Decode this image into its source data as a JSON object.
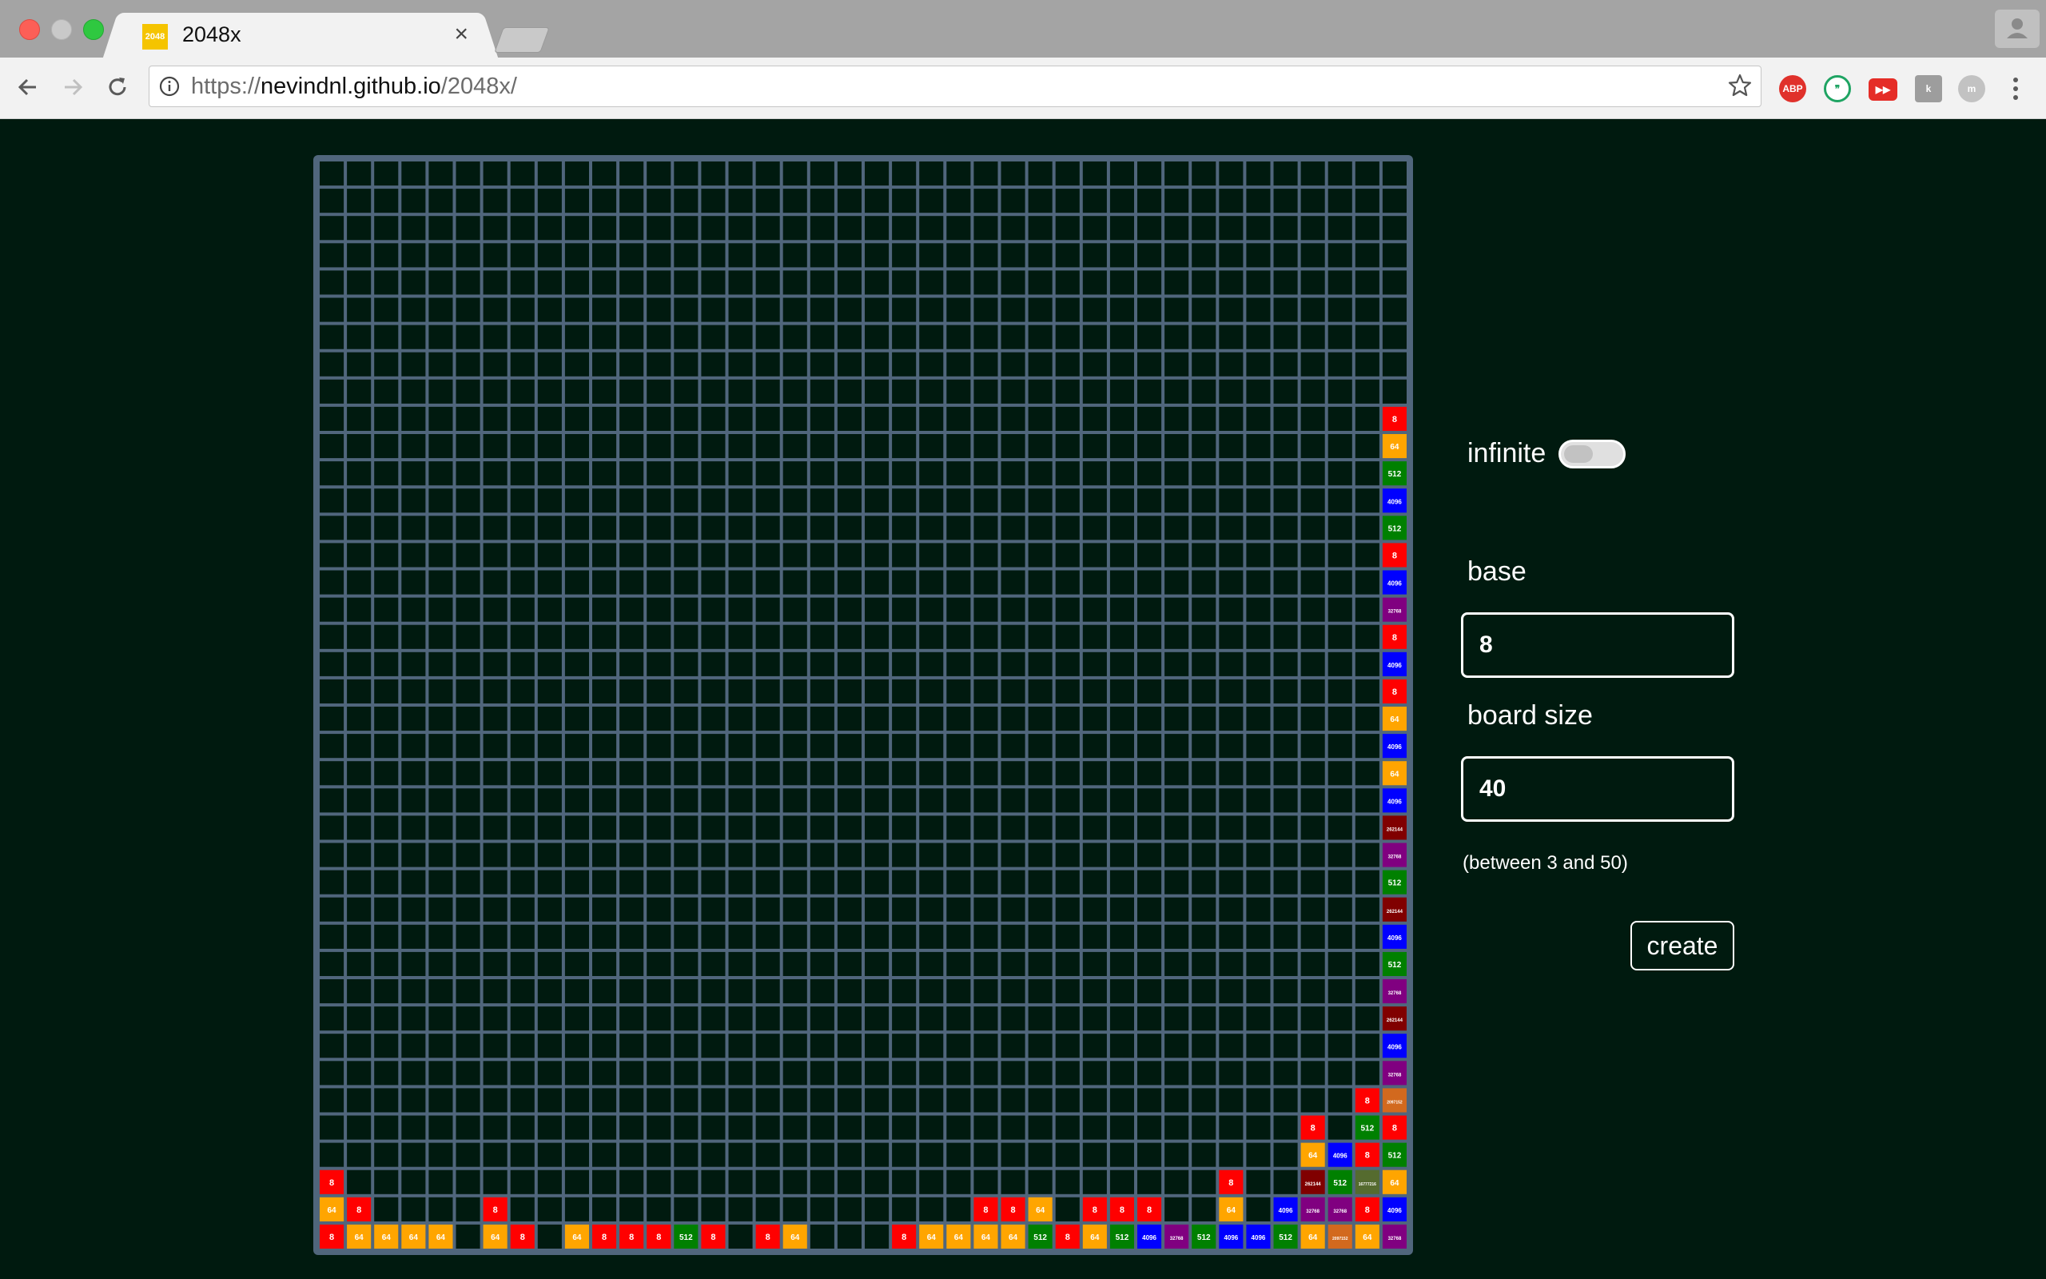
{
  "browser": {
    "tab_title": "2048x",
    "tab_favicon_text": "2048",
    "url_scheme": "https://",
    "url_host": "nevindnl.github.io",
    "url_path": "/2048x/",
    "extensions": [
      "adblock-plus-icon",
      "hangouts-icon",
      "youtube-icon",
      "k-extension-icon",
      "m-extension-icon"
    ],
    "ext_abp_label": "ABP"
  },
  "controls": {
    "infinite_label": "infinite",
    "infinite_on": false,
    "base_label": "base",
    "base_value": "8",
    "size_label": "board size",
    "size_value": "40",
    "size_note": "(between 3 and 50)",
    "create_label": "create"
  },
  "board": {
    "size": 40,
    "colors": {
      "8": "#ff0000",
      "64": "#ffa500",
      "512": "#008000",
      "4096": "#0000ff",
      "32768": "#800080",
      "262144": "#800000",
      "2097152": "#d2691e",
      "16777216": "#556b2f"
    },
    "tiles": [
      {
        "r": 9,
        "c": 39,
        "v": 8
      },
      {
        "r": 10,
        "c": 39,
        "v": 64
      },
      {
        "r": 11,
        "c": 39,
        "v": 512
      },
      {
        "r": 12,
        "c": 39,
        "v": 4096
      },
      {
        "r": 13,
        "c": 39,
        "v": 512
      },
      {
        "r": 14,
        "c": 39,
        "v": 8
      },
      {
        "r": 15,
        "c": 39,
        "v": 4096
      },
      {
        "r": 16,
        "c": 39,
        "v": 32768
      },
      {
        "r": 17,
        "c": 39,
        "v": 8
      },
      {
        "r": 18,
        "c": 39,
        "v": 4096
      },
      {
        "r": 19,
        "c": 39,
        "v": 8
      },
      {
        "r": 20,
        "c": 39,
        "v": 64
      },
      {
        "r": 21,
        "c": 39,
        "v": 4096
      },
      {
        "r": 22,
        "c": 39,
        "v": 64
      },
      {
        "r": 23,
        "c": 39,
        "v": 4096
      },
      {
        "r": 24,
        "c": 39,
        "v": 262144
      },
      {
        "r": 25,
        "c": 39,
        "v": 32768
      },
      {
        "r": 26,
        "c": 39,
        "v": 512
      },
      {
        "r": 27,
        "c": 39,
        "v": 262144
      },
      {
        "r": 28,
        "c": 39,
        "v": 4096
      },
      {
        "r": 29,
        "c": 39,
        "v": 512
      },
      {
        "r": 30,
        "c": 39,
        "v": 32768
      },
      {
        "r": 31,
        "c": 39,
        "v": 262144
      },
      {
        "r": 32,
        "c": 39,
        "v": 4096
      },
      {
        "r": 33,
        "c": 39,
        "v": 32768
      },
      {
        "r": 34,
        "c": 38,
        "v": 8
      },
      {
        "r": 34,
        "c": 39,
        "v": 2097152
      },
      {
        "r": 35,
        "c": 36,
        "v": 8
      },
      {
        "r": 35,
        "c": 38,
        "v": 512
      },
      {
        "r": 35,
        "c": 39,
        "v": 8
      },
      {
        "r": 36,
        "c": 36,
        "v": 64
      },
      {
        "r": 36,
        "c": 37,
        "v": 4096
      },
      {
        "r": 36,
        "c": 38,
        "v": 8
      },
      {
        "r": 36,
        "c": 39,
        "v": 512
      },
      {
        "r": 37,
        "c": 0,
        "v": 8
      },
      {
        "r": 37,
        "c": 33,
        "v": 8
      },
      {
        "r": 37,
        "c": 36,
        "v": 262144
      },
      {
        "r": 37,
        "c": 37,
        "v": 512
      },
      {
        "r": 37,
        "c": 38,
        "v": 16777216
      },
      {
        "r": 37,
        "c": 39,
        "v": 64
      },
      {
        "r": 38,
        "c": 0,
        "v": 64
      },
      {
        "r": 38,
        "c": 1,
        "v": 8
      },
      {
        "r": 38,
        "c": 6,
        "v": 8
      },
      {
        "r": 38,
        "c": 24,
        "v": 8
      },
      {
        "r": 38,
        "c": 25,
        "v": 8
      },
      {
        "r": 38,
        "c": 26,
        "v": 64
      },
      {
        "r": 38,
        "c": 28,
        "v": 8
      },
      {
        "r": 38,
        "c": 29,
        "v": 8
      },
      {
        "r": 38,
        "c": 30,
        "v": 8
      },
      {
        "r": 38,
        "c": 33,
        "v": 64
      },
      {
        "r": 38,
        "c": 35,
        "v": 4096
      },
      {
        "r": 38,
        "c": 36,
        "v": 32768
      },
      {
        "r": 38,
        "c": 37,
        "v": 32768
      },
      {
        "r": 38,
        "c": 38,
        "v": 8
      },
      {
        "r": 38,
        "c": 39,
        "v": 4096
      },
      {
        "r": 39,
        "c": 0,
        "v": 8
      },
      {
        "r": 39,
        "c": 1,
        "v": 64
      },
      {
        "r": 39,
        "c": 2,
        "v": 64
      },
      {
        "r": 39,
        "c": 3,
        "v": 64
      },
      {
        "r": 39,
        "c": 4,
        "v": 64
      },
      {
        "r": 39,
        "c": 6,
        "v": 64
      },
      {
        "r": 39,
        "c": 7,
        "v": 8
      },
      {
        "r": 39,
        "c": 9,
        "v": 64
      },
      {
        "r": 39,
        "c": 10,
        "v": 8
      },
      {
        "r": 39,
        "c": 11,
        "v": 8
      },
      {
        "r": 39,
        "c": 12,
        "v": 8
      },
      {
        "r": 39,
        "c": 13,
        "v": 512
      },
      {
        "r": 39,
        "c": 14,
        "v": 8
      },
      {
        "r": 39,
        "c": 16,
        "v": 8
      },
      {
        "r": 39,
        "c": 17,
        "v": 64
      },
      {
        "r": 39,
        "c": 21,
        "v": 8
      },
      {
        "r": 39,
        "c": 22,
        "v": 64
      },
      {
        "r": 39,
        "c": 23,
        "v": 64
      },
      {
        "r": 39,
        "c": 24,
        "v": 64
      },
      {
        "r": 39,
        "c": 25,
        "v": 64
      },
      {
        "r": 39,
        "c": 26,
        "v": 512
      },
      {
        "r": 39,
        "c": 27,
        "v": 8
      },
      {
        "r": 39,
        "c": 28,
        "v": 64
      },
      {
        "r": 39,
        "c": 29,
        "v": 512
      },
      {
        "r": 39,
        "c": 30,
        "v": 4096
      },
      {
        "r": 39,
        "c": 31,
        "v": 32768
      },
      {
        "r": 39,
        "c": 32,
        "v": 512
      },
      {
        "r": 39,
        "c": 33,
        "v": 4096
      },
      {
        "r": 39,
        "c": 34,
        "v": 4096
      },
      {
        "r": 39,
        "c": 35,
        "v": 512
      },
      {
        "r": 39,
        "c": 36,
        "v": 64
      },
      {
        "r": 39,
        "c": 37,
        "v": 2097152
      },
      {
        "r": 39,
        "c": 38,
        "v": 64
      },
      {
        "r": 39,
        "c": 39,
        "v": 32768
      }
    ]
  }
}
